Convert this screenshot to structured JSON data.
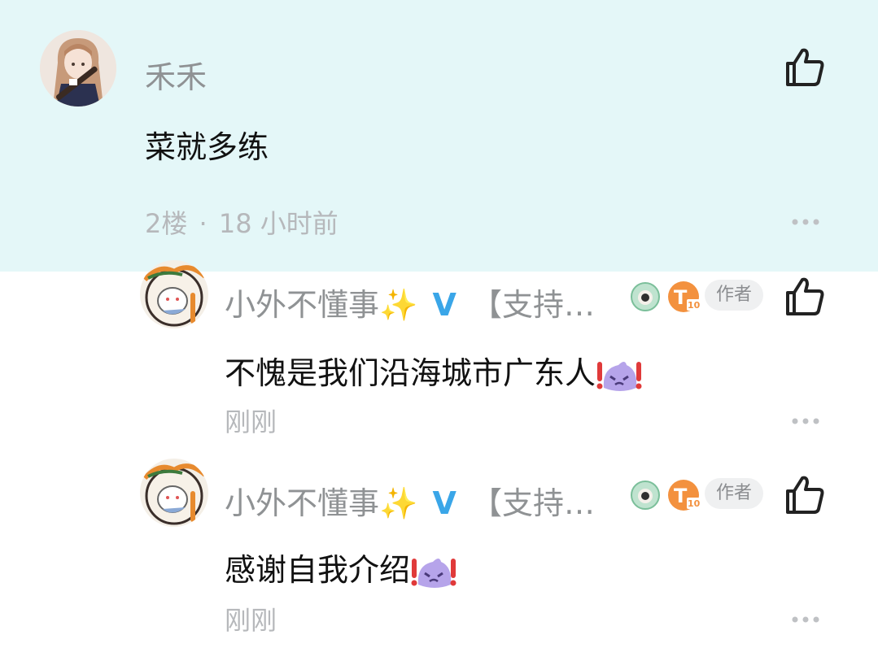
{
  "main_comment": {
    "username": "禾禾",
    "text": "菜就多练",
    "floor": "2楼",
    "separator": "·",
    "time": "18 小时前"
  },
  "replies": [
    {
      "username": "小外不懂事",
      "sparkle": "✨",
      "verified": "V",
      "bracket_text": "【支持…",
      "author_label": "作者",
      "text": "不愧是我们沿海城市广东人",
      "time": "刚刚"
    },
    {
      "username": "小外不懂事",
      "sparkle": "✨",
      "verified": "V",
      "bracket_text": "【支持…",
      "author_label": "作者",
      "text": "感谢自我介绍",
      "time": "刚刚"
    }
  ],
  "icons": {
    "like": "thumbs-up-icon",
    "more": "more-dots-icon",
    "badge1": "round-creature-badge-icon",
    "badge2": "level-t10-badge-icon",
    "emoji": "purple-blob-exclaim-emoji"
  },
  "colors": {
    "highlight_bg": "#e4f7f8",
    "username": "#8f9294",
    "verified": "#3aa6e8",
    "meta": "#b6b8bb",
    "text": "#111111"
  }
}
